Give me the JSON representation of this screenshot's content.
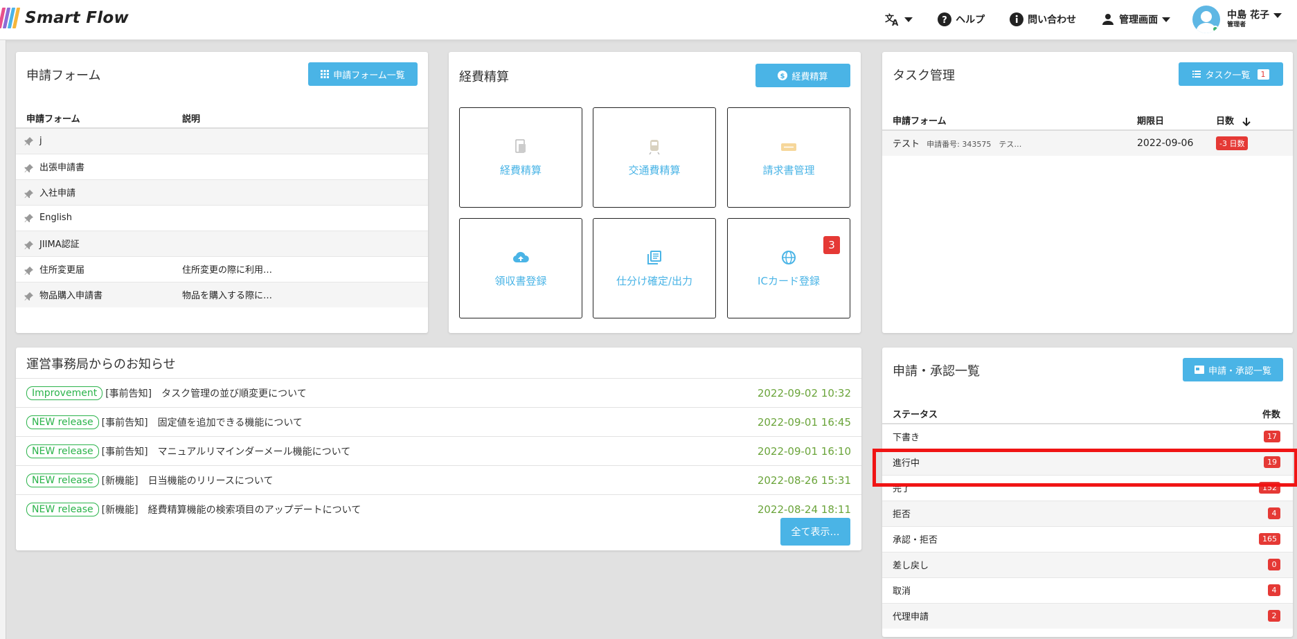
{
  "header": {
    "brand": "Smart Flow",
    "brand_colors": [
      "#e8508b",
      "#8c6bd6",
      "#4ab4e6",
      "#f6b63a"
    ],
    "language_icon": "translate-icon",
    "help_label": "ヘルプ",
    "contact_label": "問い合わせ",
    "admin_label": "管理画面",
    "user_name": "中島 花子",
    "user_role": "管理者"
  },
  "forms_panel": {
    "title": "申請フォーム",
    "button_label": "申請フォーム一覧",
    "col_form": "申請フォーム",
    "col_desc": "説明",
    "rows": [
      {
        "name": "j",
        "desc": ""
      },
      {
        "name": "出張申請書",
        "desc": ""
      },
      {
        "name": "入社申請",
        "desc": ""
      },
      {
        "name": "English",
        "desc": ""
      },
      {
        "name": "JIIMA認証",
        "desc": ""
      },
      {
        "name": "住所変更届",
        "desc": "住所変更の際に利用…"
      },
      {
        "name": "物品購入申請書",
        "desc": "物品を購入する際に…"
      }
    ]
  },
  "expense_panel": {
    "title": "経費精算",
    "button_label": "経費精算",
    "tiles": [
      {
        "label": "経費精算",
        "icon": "receipt-icon"
      },
      {
        "label": "交通費精算",
        "icon": "train-icon"
      },
      {
        "label": "請求書管理",
        "icon": "ticket-icon"
      },
      {
        "label": "領収書登録",
        "icon": "cloud-upload-icon"
      },
      {
        "label": "仕分け確定/出力",
        "icon": "library-icon"
      },
      {
        "label": "ICカード登録",
        "icon": "globe-icon",
        "badge": "3"
      }
    ]
  },
  "tasks_panel": {
    "title": "タスク管理",
    "button_label": "タスク一覧",
    "button_count": "1",
    "col_form": "申請フォーム",
    "col_due": "期限日",
    "col_days": "日数",
    "rows": [
      {
        "name": "テスト",
        "meta": "申請番号: 343575　テス…",
        "due": "2022-09-06",
        "days": "-3 日数"
      }
    ]
  },
  "news_panel": {
    "title": "運営事務局からのお知らせ",
    "show_all_label": "全て表示…",
    "items": [
      {
        "tag": "Improvement",
        "category": "[事前告知]",
        "text": "タスク管理の並び順変更について",
        "date": "2022-09-02 10:32"
      },
      {
        "tag": "NEW release",
        "category": "[事前告知]",
        "text": "固定値を追加できる機能について",
        "date": "2022-09-01 16:45"
      },
      {
        "tag": "NEW release",
        "category": "[事前告知]",
        "text": "マニュアルリマインダーメール機能について",
        "date": "2022-09-01 16:10"
      },
      {
        "tag": "NEW release",
        "category": "[新機能]",
        "text": "日当機能のリリースについて",
        "date": "2022-08-26 15:31"
      },
      {
        "tag": "NEW release",
        "category": "[新機能]",
        "text": "経費精算機能の検索項目のアップデートについて",
        "date": "2022-08-24 18:11"
      }
    ]
  },
  "approvals_panel": {
    "title": "申請・承認一覧",
    "button_label": "申請・承認一覧",
    "col_status": "ステータス",
    "col_count": "件数",
    "rows": [
      {
        "status": "下書き",
        "count": "17"
      },
      {
        "status": "進行中",
        "count": "19"
      },
      {
        "status": "完了",
        "count": "152"
      },
      {
        "status": "拒否",
        "count": "4"
      },
      {
        "status": "承認・拒否",
        "count": "165"
      },
      {
        "status": "差し戻し",
        "count": "0"
      },
      {
        "status": "取消",
        "count": "4"
      },
      {
        "status": "代理申請",
        "count": "2"
      }
    ]
  },
  "colors": {
    "accent": "#4ab4e6",
    "badge_red": "#e53935",
    "tag_green": "#2ab34a",
    "date_green": "#6aa43a",
    "highlight_red": "#f01414"
  }
}
